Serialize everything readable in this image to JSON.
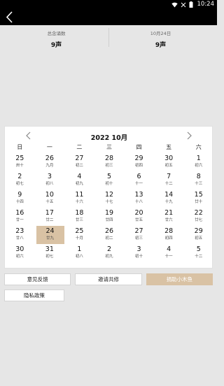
{
  "status_bar": {
    "time": "10:24",
    "icons": [
      "wifi-icon",
      "no-signal-icon",
      "battery-icon"
    ]
  },
  "app_bar": {
    "back_icon": "back-arrow-icon"
  },
  "stats": [
    {
      "label": "总念诵数",
      "value": "9声"
    },
    {
      "label": "10月24日",
      "value": "9声"
    }
  ],
  "calendar": {
    "title": "2022  10月",
    "weekdays": [
      "日",
      "一",
      "二",
      "三",
      "四",
      "五",
      "六"
    ],
    "selected_day": "24",
    "accent_color": "#d9c2a4",
    "days": [
      {
        "d": "25",
        "l": "卅十"
      },
      {
        "d": "26",
        "l": "九月"
      },
      {
        "d": "27",
        "l": "初二"
      },
      {
        "d": "28",
        "l": "初三"
      },
      {
        "d": "29",
        "l": "初四"
      },
      {
        "d": "30",
        "l": "初五"
      },
      {
        "d": "1",
        "l": "初六"
      },
      {
        "d": "2",
        "l": "初七"
      },
      {
        "d": "3",
        "l": "初八"
      },
      {
        "d": "4",
        "l": "初九"
      },
      {
        "d": "5",
        "l": "初十"
      },
      {
        "d": "6",
        "l": "十一"
      },
      {
        "d": "7",
        "l": "十二"
      },
      {
        "d": "8",
        "l": "十三"
      },
      {
        "d": "9",
        "l": "十四"
      },
      {
        "d": "10",
        "l": "十五"
      },
      {
        "d": "11",
        "l": "十六"
      },
      {
        "d": "12",
        "l": "十七"
      },
      {
        "d": "13",
        "l": "十八"
      },
      {
        "d": "14",
        "l": "十九"
      },
      {
        "d": "15",
        "l": "廿十"
      },
      {
        "d": "16",
        "l": "廿一"
      },
      {
        "d": "17",
        "l": "廿二"
      },
      {
        "d": "18",
        "l": "廿三"
      },
      {
        "d": "19",
        "l": "廿四"
      },
      {
        "d": "20",
        "l": "廿五"
      },
      {
        "d": "21",
        "l": "廿六"
      },
      {
        "d": "22",
        "l": "廿七"
      },
      {
        "d": "23",
        "l": "廿八"
      },
      {
        "d": "24",
        "l": "廿九"
      },
      {
        "d": "25",
        "l": "十月"
      },
      {
        "d": "26",
        "l": "初二"
      },
      {
        "d": "27",
        "l": "初三"
      },
      {
        "d": "28",
        "l": "初四"
      },
      {
        "d": "29",
        "l": "初五"
      },
      {
        "d": "30",
        "l": "初六"
      },
      {
        "d": "31",
        "l": "初七"
      },
      {
        "d": "1",
        "l": "初八"
      },
      {
        "d": "2",
        "l": "初九"
      },
      {
        "d": "3",
        "l": "初十"
      },
      {
        "d": "4",
        "l": "十一"
      },
      {
        "d": "5",
        "l": "十二"
      }
    ]
  },
  "buttons": {
    "feedback": "意见反馈",
    "invite": "邀请共修",
    "donate": "捐助小木鱼",
    "privacy": "隐私政策"
  }
}
